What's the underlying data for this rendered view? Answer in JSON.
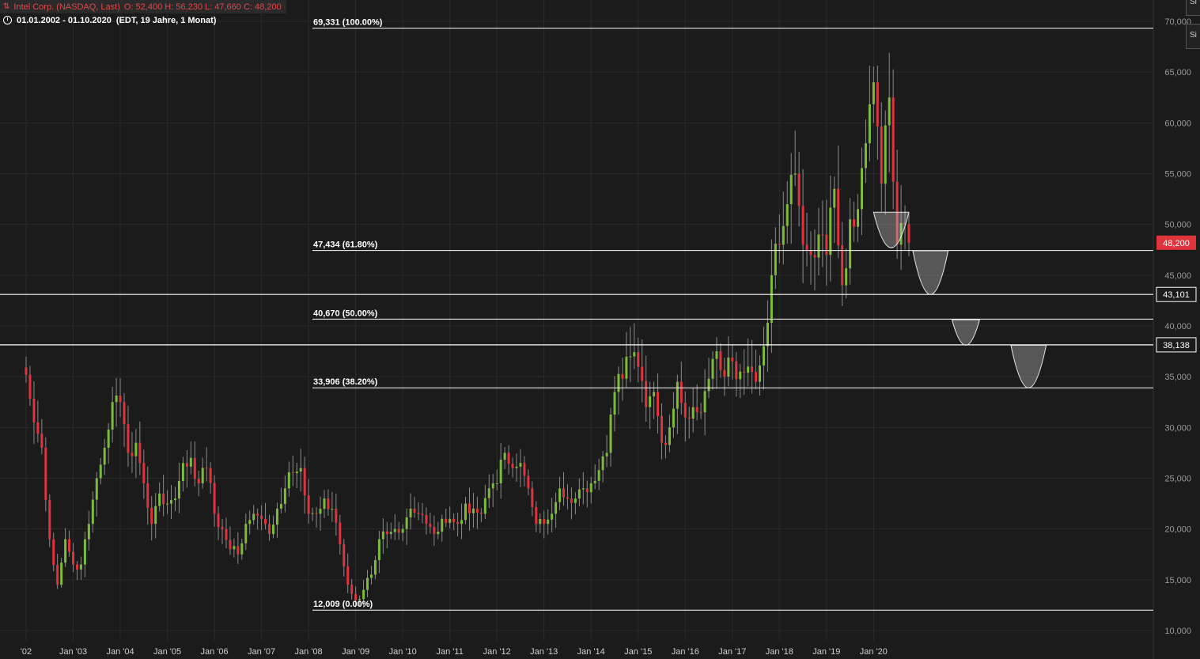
{
  "header": {
    "instrument": "Intel Corp. (NASDAQ, Last)",
    "ohlc": "O: 52,400  H: 56,230  L: 47,660  C: 48,200",
    "date_range": "01.01.2002 - 01.10.2020",
    "timezone_period": "(EDT, 19 Jahre, 1 Monat)",
    "symbol_icon": "candlestick-icon",
    "clock_icon": "clock-icon"
  },
  "side_buttons": [
    {
      "label": "Si"
    },
    {
      "label": "Si"
    }
  ],
  "colors": {
    "background": "#1b1b1b",
    "up": "#7cbc3c",
    "down": "#e0343c",
    "grid": "#2a2a2a",
    "line": "#ffffff",
    "price_badge": "#e0343c"
  },
  "chart_data": {
    "type": "candlestick",
    "title": "",
    "xlabel": "",
    "ylabel": "",
    "ylim": [
      9500,
      71000
    ],
    "y_ticks": [
      "10,000",
      "15,000",
      "20,000",
      "25,000",
      "30,000",
      "35,000",
      "40,000",
      "45,000",
      "50,000",
      "55,000",
      "60,000",
      "65,000",
      "70,000"
    ],
    "x_ticks": [
      "'02",
      "Jan '03",
      "Jan '04",
      "Jan '05",
      "Jan '06",
      "Jan '07",
      "Jan '08",
      "Jan '09",
      "Jan '10",
      "Jan '11",
      "Jan '12",
      "Jan '13",
      "Jan '14",
      "Jan '15",
      "Jan '16",
      "Jan '17",
      "Jan '18",
      "Jan '19",
      "Jan '20"
    ],
    "x_range": [
      "2002-01",
      "2020-10"
    ],
    "grid": true,
    "fib_levels": [
      {
        "label": "69,331 (100.00%)",
        "value": 69.331
      },
      {
        "label": "47,434 (61.80%)",
        "value": 47.434
      },
      {
        "label": "40,670 (50.00%)",
        "value": 40.67
      },
      {
        "label": "33,906 (38.20%)",
        "value": 33.906
      },
      {
        "label": "12,009 (0.00%)",
        "value": 12.009
      }
    ],
    "horizontal_lines": [
      {
        "label": "43,101",
        "value": 43.101
      },
      {
        "label": "38,138",
        "value": 38.138
      }
    ],
    "last_price": {
      "label": "48,200",
      "value": 48.2
    },
    "bowls": [
      {
        "from": "2020-01",
        "to": "2020-10",
        "top": 51.2,
        "bottom": 47.7
      },
      {
        "from": "2020-11",
        "to": "2021-08",
        "top": 47.4,
        "bottom": 43.1
      },
      {
        "from": "2021-09",
        "to": "2022-04",
        "top": 40.6,
        "bottom": 38.1
      },
      {
        "from": "2022-12",
        "to": "2023-09",
        "top": 38.1,
        "bottom": 33.9
      }
    ],
    "anchors": [
      [
        "2002-01",
        35.2
      ],
      [
        "2002-03",
        30.5
      ],
      [
        "2002-05",
        28.0
      ],
      [
        "2002-07",
        19.0
      ],
      [
        "2002-09",
        14.5
      ],
      [
        "2002-11",
        19.0
      ],
      [
        "2003-01",
        16.5
      ],
      [
        "2003-03",
        16.5
      ],
      [
        "2003-05",
        20.5
      ],
      [
        "2003-07",
        25.0
      ],
      [
        "2003-09",
        28.0
      ],
      [
        "2003-11",
        32.5
      ],
      [
        "2004-01",
        32.5
      ],
      [
        "2004-03",
        27.5
      ],
      [
        "2004-05",
        28.5
      ],
      [
        "2004-07",
        24.5
      ],
      [
        "2004-09",
        20.5
      ],
      [
        "2004-11",
        23.5
      ],
      [
        "2005-01",
        22.5
      ],
      [
        "2005-03",
        23.0
      ],
      [
        "2005-05",
        26.5
      ],
      [
        "2005-07",
        27.0
      ],
      [
        "2005-09",
        24.5
      ],
      [
        "2005-11",
        26.0
      ],
      [
        "2006-01",
        21.5
      ],
      [
        "2006-03",
        20.0
      ],
      [
        "2006-05",
        18.0
      ],
      [
        "2006-07",
        17.5
      ],
      [
        "2006-09",
        20.5
      ],
      [
        "2006-11",
        21.5
      ],
      [
        "2007-01",
        21.0
      ],
      [
        "2007-03",
        19.5
      ],
      [
        "2007-05",
        22.0
      ],
      [
        "2007-07",
        24.0
      ],
      [
        "2007-09",
        25.5
      ],
      [
        "2007-11",
        26.0
      ],
      [
        "2008-01",
        21.5
      ],
      [
        "2008-03",
        21.5
      ],
      [
        "2008-05",
        23.0
      ],
      [
        "2008-07",
        22.0
      ],
      [
        "2008-09",
        18.5
      ],
      [
        "2008-11",
        14.5
      ],
      [
        "2009-01",
        13.0
      ],
      [
        "2009-03",
        14.0
      ],
      [
        "2009-05",
        15.5
      ],
      [
        "2009-07",
        19.0
      ],
      [
        "2009-09",
        19.5
      ],
      [
        "2009-11",
        20.0
      ],
      [
        "2010-01",
        20.0
      ],
      [
        "2010-03",
        22.0
      ],
      [
        "2010-05",
        21.5
      ],
      [
        "2010-07",
        20.5
      ],
      [
        "2010-09",
        19.5
      ],
      [
        "2010-11",
        21.0
      ],
      [
        "2011-01",
        21.0
      ],
      [
        "2011-03",
        20.5
      ],
      [
        "2011-05",
        22.5
      ],
      [
        "2011-07",
        22.0
      ],
      [
        "2011-09",
        21.5
      ],
      [
        "2011-11",
        24.0
      ],
      [
        "2012-01",
        24.5
      ],
      [
        "2012-03",
        27.5
      ],
      [
        "2012-05",
        26.0
      ],
      [
        "2012-07",
        26.5
      ],
      [
        "2012-09",
        24.0
      ],
      [
        "2012-11",
        20.5
      ],
      [
        "2013-01",
        20.5
      ],
      [
        "2013-03",
        21.5
      ],
      [
        "2013-05",
        24.0
      ],
      [
        "2013-07",
        23.0
      ],
      [
        "2013-09",
        23.0
      ],
      [
        "2013-11",
        24.0
      ],
      [
        "2014-01",
        24.5
      ],
      [
        "2014-03",
        25.8
      ],
      [
        "2014-05",
        27.5
      ],
      [
        "2014-07",
        33.5
      ],
      [
        "2014-09",
        34.8
      ],
      [
        "2014-11",
        37.0
      ],
      [
        "2015-01",
        36.0
      ],
      [
        "2015-03",
        32.0
      ],
      [
        "2015-05",
        33.5
      ],
      [
        "2015-07",
        28.5
      ],
      [
        "2015-09",
        30.0
      ],
      [
        "2015-11",
        34.5
      ],
      [
        "2016-01",
        31.0
      ],
      [
        "2016-03",
        32.0
      ],
      [
        "2016-05",
        31.5
      ],
      [
        "2016-07",
        34.8
      ],
      [
        "2016-09",
        37.5
      ],
      [
        "2016-11",
        35.0
      ],
      [
        "2017-01",
        36.5
      ],
      [
        "2017-03",
        35.5
      ],
      [
        "2017-05",
        36.0
      ],
      [
        "2017-07",
        34.5
      ],
      [
        "2017-09",
        38.0
      ],
      [
        "2017-11",
        45.0
      ],
      [
        "2018-01",
        48.0
      ],
      [
        "2018-03",
        52.0
      ],
      [
        "2018-05",
        55.0
      ],
      [
        "2018-07",
        48.0
      ],
      [
        "2018-09",
        47.0
      ],
      [
        "2018-11",
        49.0
      ],
      [
        "2019-01",
        47.0
      ],
      [
        "2019-03",
        53.5
      ],
      [
        "2019-05",
        44.0
      ],
      [
        "2019-07",
        50.5
      ],
      [
        "2019-09",
        51.5
      ],
      [
        "2019-11",
        58.0
      ],
      [
        "2020-01",
        64.0
      ],
      [
        "2020-03",
        54.0
      ],
      [
        "2020-05",
        62.5
      ],
      [
        "2020-07",
        48.0
      ],
      [
        "2020-09",
        50.0
      ],
      [
        "2020-10",
        48.2
      ]
    ]
  }
}
